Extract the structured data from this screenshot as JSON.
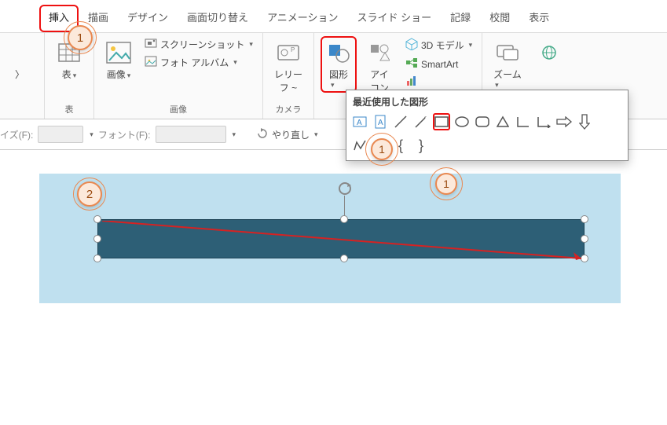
{
  "callouts": {
    "top_tab": "1",
    "shapes_btn": "1",
    "rect_shape": "1",
    "canvas": "2"
  },
  "tabs": [
    "挿入",
    "描画",
    "デザイン",
    "画面切り替え",
    "アニメーション",
    "スライド ショー",
    "記録",
    "校閲",
    "表示"
  ],
  "groups": {
    "tables": {
      "label": "表",
      "btn_table": "表"
    },
    "images": {
      "label": "画像",
      "btn_images": "画像",
      "btn_screenshot": "スクリーンショット",
      "btn_photoalbum": "フォト アルバム"
    },
    "camera": {
      "label": "カメラ",
      "btn_relief": "レリー\nフ ~"
    },
    "illus": {
      "btn_shapes": "図形",
      "btn_icons": "アイ\nコン",
      "btn_3d": "3D モデル",
      "btn_smartart": "SmartArt"
    },
    "zoom": {
      "btn_zoom": "ズーム"
    }
  },
  "shapes_popup": {
    "title": "最近使用した図形"
  },
  "fmt_row": {
    "size": "イズ(F):",
    "font": "フォント(F):",
    "undo": "やり直し"
  }
}
